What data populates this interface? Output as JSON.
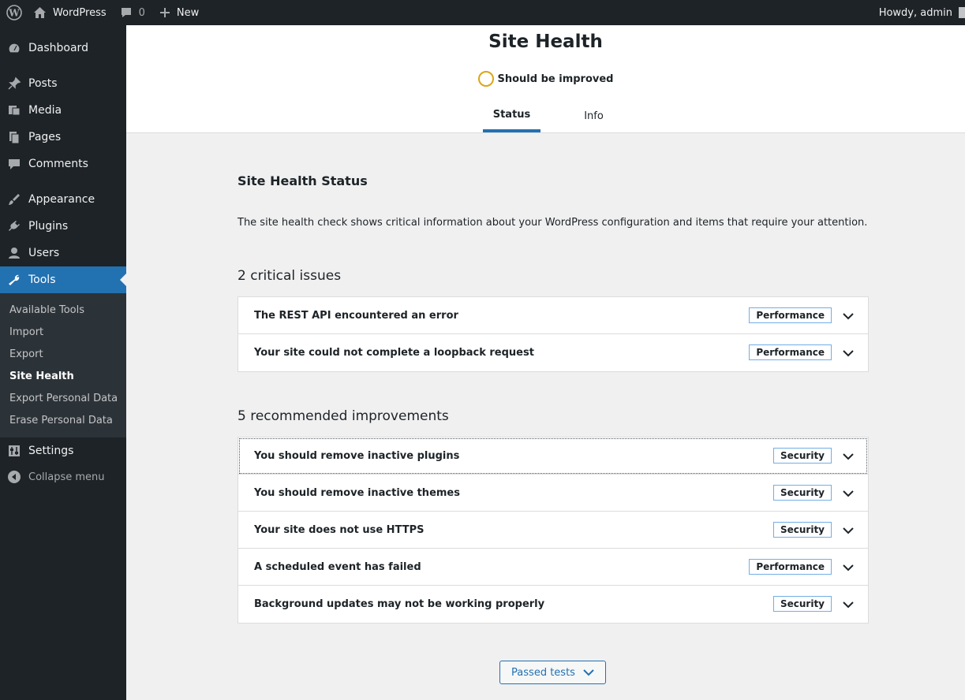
{
  "adminbar": {
    "site_name": "WordPress",
    "comments_count": "0",
    "new_label": "New",
    "account_label": "Howdy, admin"
  },
  "sidebar": {
    "items": [
      {
        "label": "Dashboard",
        "icon": "dashboard-icon"
      },
      {
        "label": "Posts",
        "icon": "pin-icon"
      },
      {
        "label": "Media",
        "icon": "media-icon"
      },
      {
        "label": "Pages",
        "icon": "pages-icon"
      },
      {
        "label": "Comments",
        "icon": "comment-icon"
      },
      {
        "label": "Appearance",
        "icon": "brush-icon"
      },
      {
        "label": "Plugins",
        "icon": "plugin-icon"
      },
      {
        "label": "Users",
        "icon": "user-icon"
      },
      {
        "label": "Tools",
        "icon": "wrench-icon"
      },
      {
        "label": "Settings",
        "icon": "settings-icon"
      }
    ],
    "submenu": [
      "Available Tools",
      "Import",
      "Export",
      "Site Health",
      "Export Personal Data",
      "Erase Personal Data"
    ],
    "collapse_label": "Collapse menu"
  },
  "header": {
    "title": "Site Health",
    "status": "Should be improved",
    "tabs": [
      "Status",
      "Info"
    ]
  },
  "main": {
    "heading": "Site Health Status",
    "description": "The site health check shows critical information about your WordPress configuration and items that require your attention.",
    "critical_title": "2 critical issues",
    "critical": [
      {
        "label": "The REST API encountered an error",
        "badge": "Performance"
      },
      {
        "label": "Your site could not complete a loopback request",
        "badge": "Performance"
      }
    ],
    "recommended_title": "5 recommended improvements",
    "recommended": [
      {
        "label": "You should remove inactive plugins",
        "badge": "Security"
      },
      {
        "label": "You should remove inactive themes",
        "badge": "Security"
      },
      {
        "label": "Your site does not use HTTPS",
        "badge": "Security"
      },
      {
        "label": "A scheduled event has failed",
        "badge": "Performance"
      },
      {
        "label": "Background updates may not be working properly",
        "badge": "Security"
      }
    ],
    "passed_tests_label": "Passed tests"
  },
  "colors": {
    "accent": "#2271b1",
    "sidebar_bg": "#1d2327",
    "status_ring": "#dba617",
    "badge_border": "#72aee6"
  }
}
